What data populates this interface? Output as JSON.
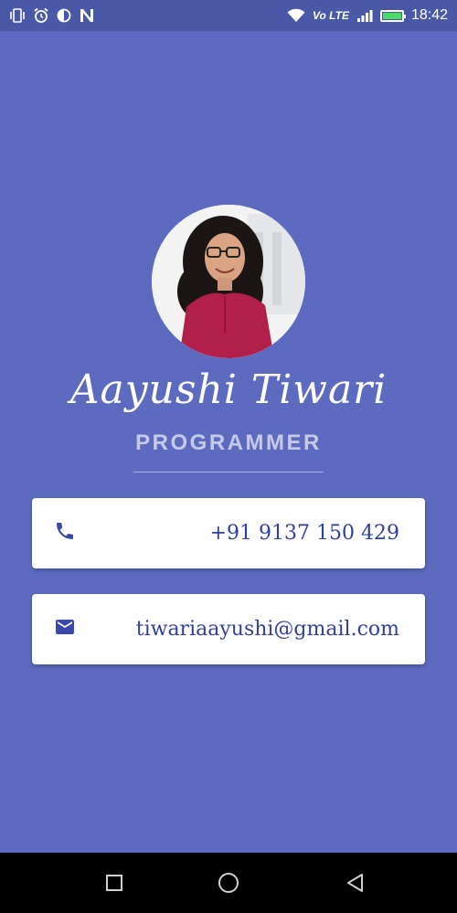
{
  "status_bar": {
    "time": "18:42",
    "network_label": "Vo LTE",
    "battery_level": 1.0,
    "icons": [
      "vibrate-icon",
      "alarm-icon",
      "data-saver-icon",
      "n-notification-icon",
      "wifi-icon",
      "volte-icon",
      "signal-icon",
      "battery-icon"
    ],
    "battery_color": "#4cd964"
  },
  "profile": {
    "name": "Aayushi Tiwari",
    "title": "PROGRAMMER",
    "avatar_icon": "profile-photo"
  },
  "contacts": {
    "phone": {
      "icon": "phone-icon",
      "text": "+91 9137 150 429"
    },
    "email": {
      "icon": "mail-icon",
      "text": "tiwariaayushi@gmail.com"
    }
  },
  "nav_bar": {
    "buttons": [
      "recents-square-icon",
      "home-circle-icon",
      "back-triangle-icon"
    ]
  },
  "colors": {
    "background": "#5c6bc0",
    "status_bar": "#4a58a8",
    "accent_text": "#303f9f",
    "subtitle": "#c5cae9"
  }
}
